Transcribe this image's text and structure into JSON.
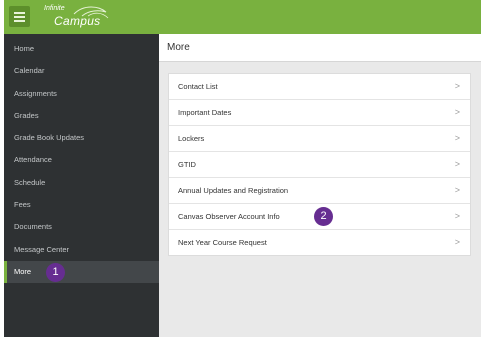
{
  "app": {
    "logo_top": "Infinite",
    "logo_main": "Campus"
  },
  "sidebar": {
    "items": [
      {
        "label": "Home",
        "active": false
      },
      {
        "label": "Calendar",
        "active": false
      },
      {
        "label": "Assignments",
        "active": false
      },
      {
        "label": "Grades",
        "active": false
      },
      {
        "label": "Grade Book Updates",
        "active": false
      },
      {
        "label": "Attendance",
        "active": false
      },
      {
        "label": "Schedule",
        "active": false
      },
      {
        "label": "Fees",
        "active": false
      },
      {
        "label": "Documents",
        "active": false
      },
      {
        "label": "Message Center",
        "active": false
      },
      {
        "label": "More",
        "active": true
      }
    ]
  },
  "main": {
    "title": "More",
    "rows": [
      {
        "label": "Contact List"
      },
      {
        "label": "Important Dates"
      },
      {
        "label": "Lockers"
      },
      {
        "label": "GTID"
      },
      {
        "label": "Annual Updates and Registration"
      },
      {
        "label": "Canvas Observer Account Info"
      },
      {
        "label": "Next Year Course Request"
      }
    ],
    "chevron": ">"
  },
  "annotations": {
    "badge_1": "1",
    "badge_2": "2"
  },
  "colors": {
    "brand_green": "#79b13f",
    "sidebar_bg": "#2e3133",
    "badge_purple": "#662d91"
  }
}
